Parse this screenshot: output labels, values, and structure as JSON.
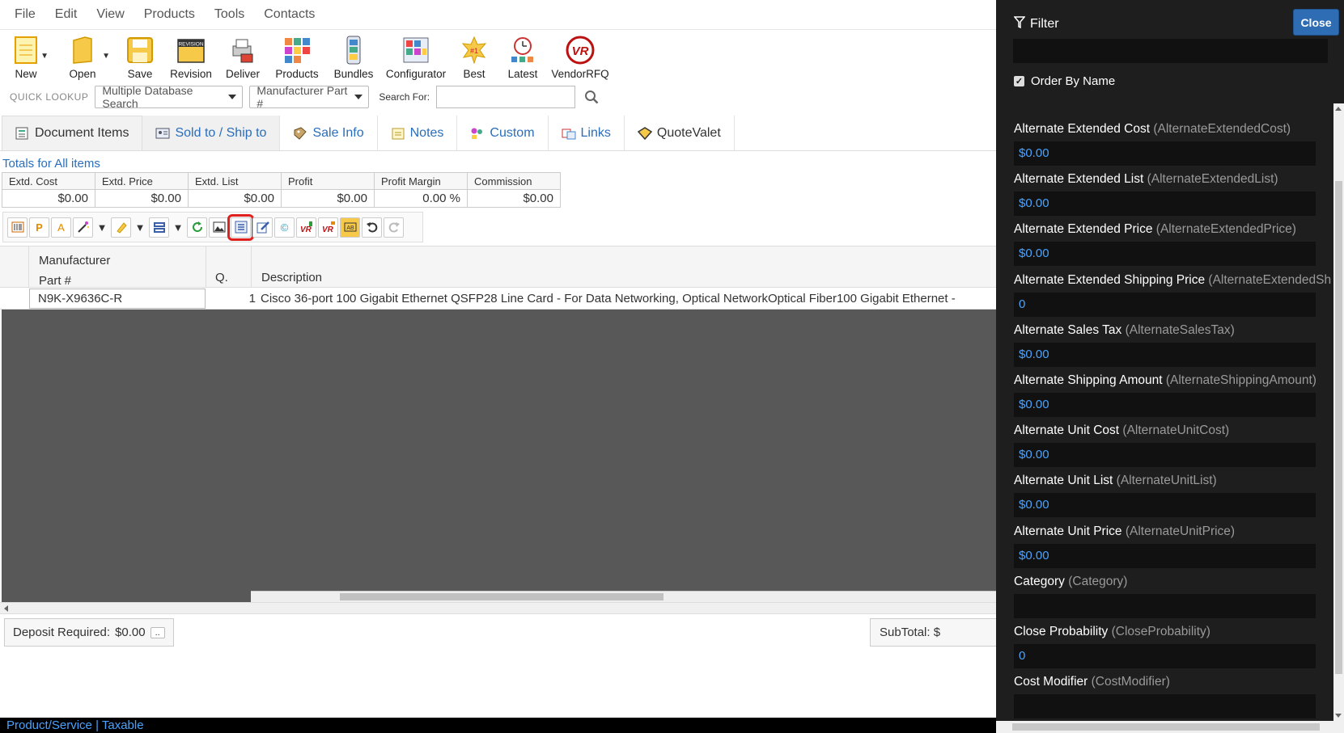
{
  "menu": [
    "File",
    "Edit",
    "View",
    "Products",
    "Tools",
    "Contacts"
  ],
  "toolbar": {
    "buttons": [
      {
        "label": "New",
        "icon": "new-document-icon"
      },
      {
        "label": "Open",
        "icon": "folder-open-icon"
      },
      {
        "label": "Save",
        "icon": "save-icon"
      },
      {
        "label": "Revision",
        "icon": "revision-icon"
      },
      {
        "label": "Deliver",
        "icon": "deliver-icon"
      },
      {
        "label": "Products",
        "icon": "products-icon"
      },
      {
        "label": "Bundles",
        "icon": "bundles-icon"
      },
      {
        "label": "Configurator",
        "icon": "configurator-icon"
      },
      {
        "label": "Best",
        "icon": "best-icon"
      },
      {
        "label": "Latest",
        "icon": "latest-icon"
      },
      {
        "label": "VendorRFQ",
        "icon": "vendorrfq-icon"
      }
    ]
  },
  "quick_lookup": {
    "label": "QUICK LOOKUP",
    "database": "Multiple Database Search",
    "field": "Manufacturer Part #",
    "search_label": "Search For:",
    "search_value": ""
  },
  "tabs": [
    "Document Items",
    "Sold to / Ship to",
    "Sale Info",
    "Notes",
    "Custom",
    "Links",
    "QuoteValet"
  ],
  "totals": {
    "title": "Totals for All items",
    "headers": [
      "Extd. Cost",
      "Extd. Price",
      "Extd. List",
      "Profit",
      "Profit Margin",
      "Commission"
    ],
    "values": [
      "$0.00",
      "$0.00",
      "$0.00",
      "$0.00",
      "0.00 %",
      "$0.00"
    ]
  },
  "grid": {
    "col_part_line1": "Manufacturer",
    "col_part_line2": "Part #",
    "col_qty": "Q.",
    "col_desc": "Description",
    "rows": [
      {
        "part": "N9K-X9636C-R",
        "qty": "1",
        "desc": "Cisco 36-port 100 Gigabit Ethernet QSFP28 Line Card - For Data Networking, Optical NetworkOptical Fiber100 Gigabit Ethernet -"
      }
    ]
  },
  "footer": {
    "deposit_label": "Deposit Required:",
    "deposit_value": "$0.00",
    "deposit_btn": "..",
    "subtotal_label": "SubTotal:",
    "subtotal_value": "$"
  },
  "status": {
    "left": "Product/Service",
    "sep": "|",
    "right": "Taxable"
  },
  "panel": {
    "title": "Filter",
    "close_label": "Close",
    "filter_value": "",
    "order_by_label": "Order By Name",
    "order_by_checked": true,
    "fields": [
      {
        "label": "Alternate Extended Cost",
        "key": "(AlternateExtendedCost)",
        "value": "$0.00"
      },
      {
        "label": "Alternate Extended List",
        "key": "(AlternateExtendedList)",
        "value": "$0.00"
      },
      {
        "label": "Alternate Extended Price",
        "key": "(AlternateExtendedPrice)",
        "value": "$0.00"
      },
      {
        "label": "Alternate Extended Shipping Price",
        "key": "(AlternateExtendedSh",
        "value": "0"
      },
      {
        "label": "Alternate Sales Tax",
        "key": "(AlternateSalesTax)",
        "value": "$0.00"
      },
      {
        "label": "Alternate Shipping Amount",
        "key": "(AlternateShippingAmount)",
        "value": "$0.00"
      },
      {
        "label": "Alternate Unit Cost",
        "key": "(AlternateUnitCost)",
        "value": "$0.00"
      },
      {
        "label": "Alternate Unit List",
        "key": "(AlternateUnitList)",
        "value": "$0.00"
      },
      {
        "label": "Alternate Unit Price",
        "key": "(AlternateUnitPrice)",
        "value": "$0.00"
      },
      {
        "label": "Category",
        "key": "(Category)",
        "value": ""
      },
      {
        "label": "Close Probability",
        "key": "(CloseProbability)",
        "value": "0"
      },
      {
        "label": "Cost Modifier",
        "key": "(CostModifier)",
        "value": ""
      }
    ]
  },
  "colors": {
    "link_blue": "#2a6ebb",
    "panel_bg": "#1e1e1e",
    "value_blue": "#4aa3ff",
    "highlight_red": "#e0201c",
    "close_btn": "#2e6db4"
  }
}
